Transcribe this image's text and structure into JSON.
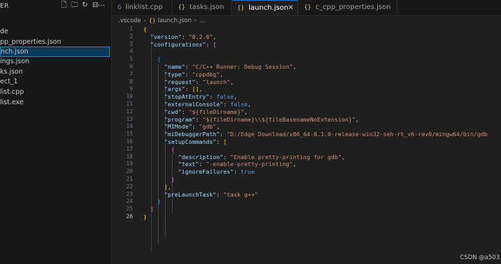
{
  "explorer": {
    "title": "ER",
    "items": [
      {
        "label": "de"
      },
      {
        "label": "pp_properties.json"
      },
      {
        "label": "nch.json",
        "selected": true
      },
      {
        "label": "ings.json"
      },
      {
        "label": "ks.json"
      },
      {
        "label": "ect_1"
      },
      {
        "label": "list.cpp"
      },
      {
        "label": "list.exe"
      }
    ],
    "actions": [
      "new-file-icon",
      "new-folder-icon",
      "refresh-icon",
      "collapse-all-icon"
    ]
  },
  "tabs": [
    {
      "label": "linklist.cpp",
      "icon": "G"
    },
    {
      "label": "tasks.json",
      "icon": "{}"
    },
    {
      "label": "launch.json",
      "icon": "{}",
      "active": true
    },
    {
      "label": "c_cpp_properties.json",
      "icon": "{}"
    }
  ],
  "breadcrumb": {
    "folder": ".vscode",
    "file": "launch.json",
    "tail": "..."
  },
  "code": {
    "line_numbers": [
      "1",
      "2",
      "3",
      "4",
      "5",
      "6",
      "7",
      "8",
      "9",
      "10",
      "11",
      "12",
      "13",
      "14",
      "15",
      "16",
      "17",
      "18",
      "19",
      "20",
      "21",
      "22",
      "23",
      "24",
      "25",
      "26"
    ],
    "current_line": 26,
    "lines": [
      [
        [
          "b1",
          "{"
        ]
      ],
      [
        [
          "p",
          "  "
        ],
        [
          "k",
          "\"version\""
        ],
        [
          "p",
          ": "
        ],
        [
          "s",
          "\"0.2.0\""
        ],
        [
          "p",
          ","
        ]
      ],
      [
        [
          "p",
          "  "
        ],
        [
          "k",
          "\"configurations\""
        ],
        [
          "p",
          ": "
        ],
        [
          "b2",
          "["
        ]
      ],
      [],
      [
        [
          "p",
          "    "
        ],
        [
          "b3",
          "{"
        ]
      ],
      [
        [
          "p",
          "      "
        ],
        [
          "k",
          "\"name\""
        ],
        [
          "p",
          ": "
        ],
        [
          "s",
          "\"C/C++ Runner: Debug Session\""
        ],
        [
          "p",
          ","
        ]
      ],
      [
        [
          "p",
          "      "
        ],
        [
          "k",
          "\"type\""
        ],
        [
          "p",
          ": "
        ],
        [
          "s",
          "\"cppdbg\""
        ],
        [
          "p",
          ","
        ]
      ],
      [
        [
          "p",
          "      "
        ],
        [
          "k",
          "\"request\""
        ],
        [
          "p",
          ": "
        ],
        [
          "s",
          "\"launch\""
        ],
        [
          "p",
          ","
        ]
      ],
      [
        [
          "p",
          "      "
        ],
        [
          "k",
          "\"args\""
        ],
        [
          "p",
          ": "
        ],
        [
          "b1",
          "[]"
        ],
        [
          "p",
          ","
        ]
      ],
      [
        [
          "p",
          "      "
        ],
        [
          "k",
          "\"stopAtEntry\""
        ],
        [
          "p",
          ": "
        ],
        [
          "kw",
          "false"
        ],
        [
          "p",
          ","
        ]
      ],
      [
        [
          "p",
          "      "
        ],
        [
          "k",
          "\"externalConsole\""
        ],
        [
          "p",
          ": "
        ],
        [
          "kw",
          "false"
        ],
        [
          "p",
          ","
        ]
      ],
      [
        [
          "p",
          "      "
        ],
        [
          "k",
          "\"cwd\""
        ],
        [
          "p",
          ": "
        ],
        [
          "s",
          "\"${fileDirname}\""
        ],
        [
          "p",
          ","
        ]
      ],
      [
        [
          "p",
          "      "
        ],
        [
          "k",
          "\"program\""
        ],
        [
          "p",
          ": "
        ],
        [
          "s",
          "\"${fileDirname}\\\\${fileBasenameNoExtension}\""
        ],
        [
          "p",
          ","
        ]
      ],
      [
        [
          "p",
          "      "
        ],
        [
          "k",
          "\"MIMode\""
        ],
        [
          "p",
          ": "
        ],
        [
          "s",
          "\"gdb\""
        ],
        [
          "p",
          ","
        ]
      ],
      [
        [
          "p",
          "      "
        ],
        [
          "k",
          "\"miDebuggerPath\""
        ],
        [
          "p",
          ": "
        ],
        [
          "s",
          "\"D:/Edge Download/x86_64-8.1.0-release-win32-seh-rt_v6-rev0/mingw64/bin/gdb"
        ]
      ],
      [
        [
          "p",
          "      "
        ],
        [
          "k",
          "\"setupCommands\""
        ],
        [
          "p",
          ": "
        ],
        [
          "b1",
          "["
        ]
      ],
      [
        [
          "p",
          "        "
        ],
        [
          "b2",
          "{"
        ]
      ],
      [
        [
          "p",
          "          "
        ],
        [
          "k",
          "\"description\""
        ],
        [
          "p",
          ": "
        ],
        [
          "s",
          "\"Enable pretty-printing for gdb\""
        ],
        [
          "p",
          ","
        ]
      ],
      [
        [
          "p",
          "          "
        ],
        [
          "k",
          "\"text\""
        ],
        [
          "p",
          ": "
        ],
        [
          "s",
          "\"-enable-pretty-printing\""
        ],
        [
          "p",
          ","
        ]
      ],
      [
        [
          "p",
          "          "
        ],
        [
          "k",
          "\"ignoreFailures\""
        ],
        [
          "p",
          ": "
        ],
        [
          "kw",
          "true"
        ]
      ],
      [
        [
          "p",
          "        "
        ],
        [
          "b2",
          "}"
        ]
      ],
      [
        [
          "p",
          "      "
        ],
        [
          "b1",
          "]"
        ],
        [
          "p",
          ","
        ]
      ],
      [
        [
          "p",
          "      "
        ],
        [
          "k",
          "\"preLaunchTask\""
        ],
        [
          "p",
          ": "
        ],
        [
          "s",
          "\"task g++\""
        ]
      ],
      [
        [
          "p",
          "    "
        ],
        [
          "b3",
          "}"
        ]
      ],
      [
        [
          "p",
          "  "
        ],
        [
          "b2",
          "]"
        ]
      ],
      [
        [
          "b1",
          "}"
        ]
      ]
    ]
  },
  "watermark": "CSDN @a503"
}
